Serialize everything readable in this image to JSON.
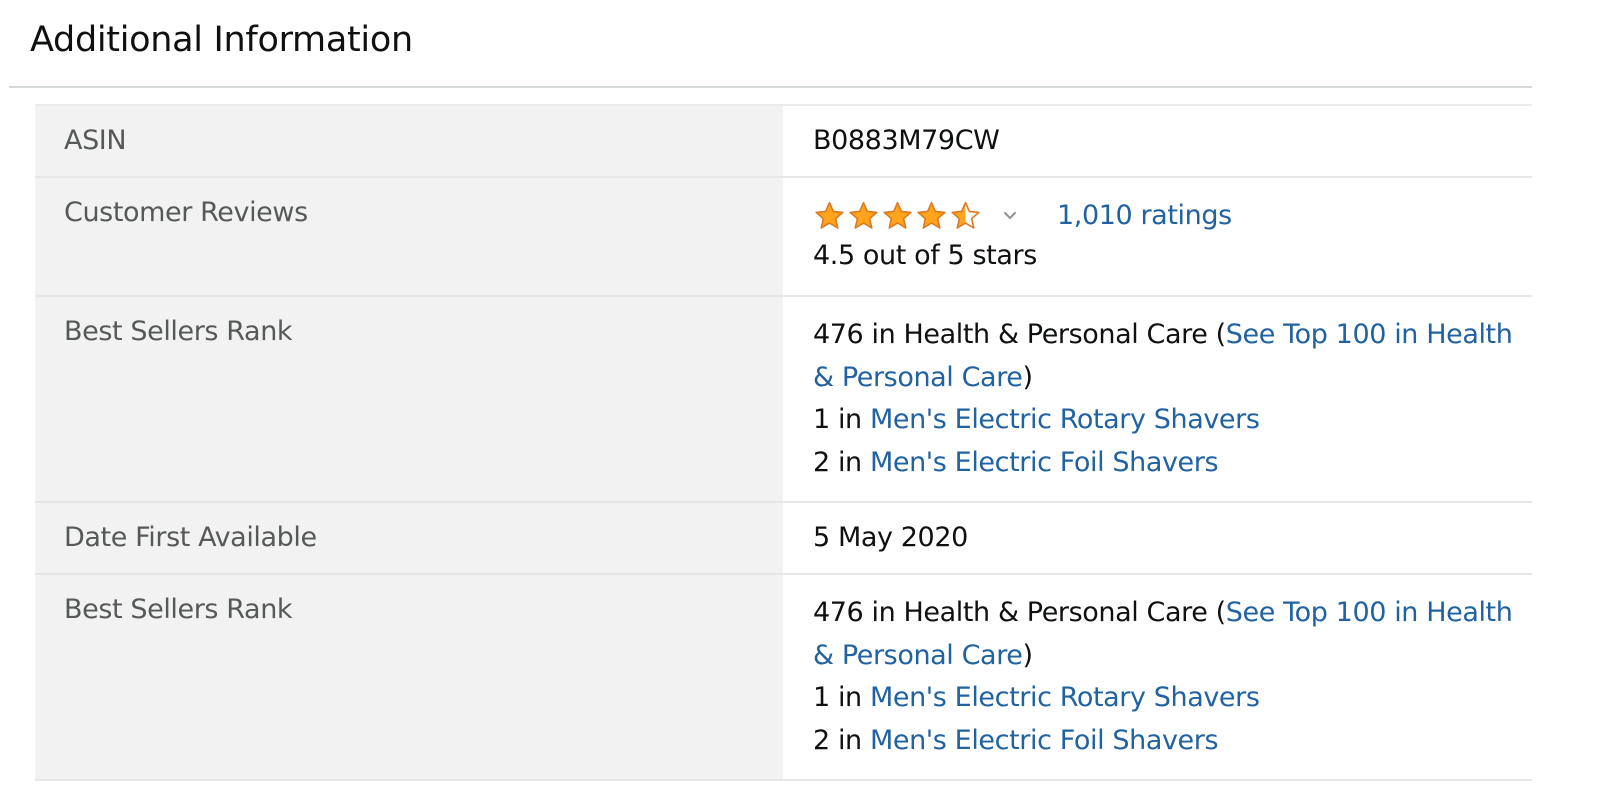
{
  "section": {
    "title": "Additional Information"
  },
  "colors": {
    "link": "#2162a1",
    "star": "#ffa41c",
    "label_bg": "#f2f2f2"
  },
  "rows": {
    "asin": {
      "label": "ASIN",
      "value": "B0883M79CW"
    },
    "reviews": {
      "label": "Customer Reviews",
      "rating": 4.5,
      "max_rating": 5,
      "icon": "star-rating-icon",
      "ratings_link": "1,010 ratings",
      "rating_text": "4.5 out of 5 stars"
    },
    "bsr1": {
      "label": "Best Sellers Rank",
      "line1_prefix": "476 in Health & Personal Care (",
      "line1_link": "See Top 100 in Health & Personal Care",
      "line1_suffix": ")",
      "line2_prefix": "1 in ",
      "line2_link": "Men's Electric Rotary Shavers",
      "line3_prefix": "2 in ",
      "line3_link": "Men's Electric Foil Shavers"
    },
    "date": {
      "label": "Date First Available",
      "value": "5 May 2020"
    },
    "bsr2": {
      "label": "Best Sellers Rank",
      "line1_prefix": "476 in Health & Personal Care (",
      "line1_link": "See Top 100 in Health & Personal Care",
      "line1_suffix": ")",
      "line2_prefix": "1 in ",
      "line2_link": "Men's Electric Rotary Shavers",
      "line3_prefix": "2 in ",
      "line3_link": "Men's Electric Foil Shavers"
    }
  }
}
